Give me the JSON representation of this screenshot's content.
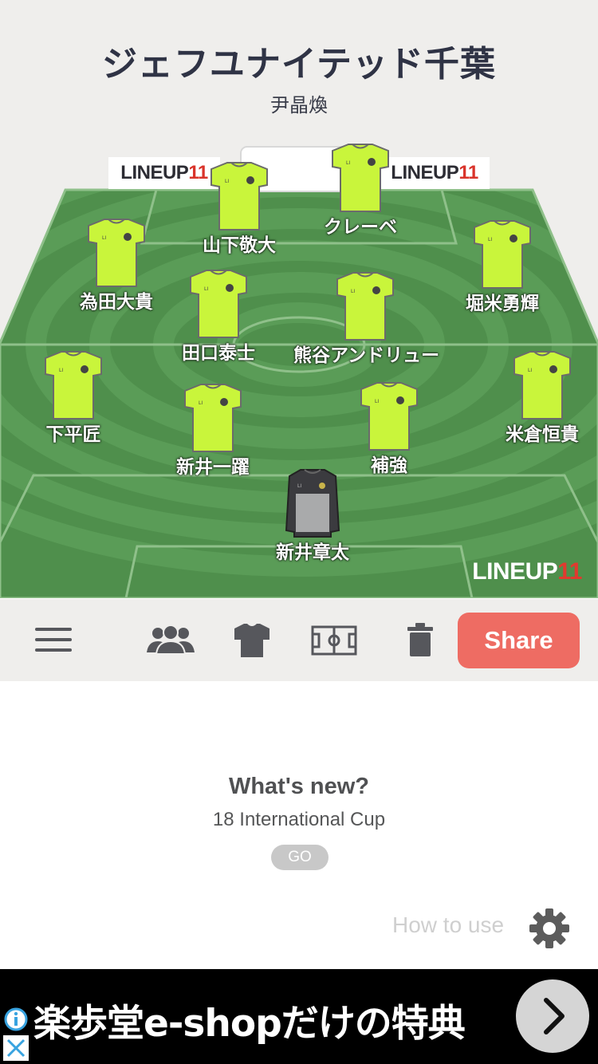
{
  "team": {
    "name": "ジェフユナイテッド千葉",
    "coach": "尹晶煥"
  },
  "brand": {
    "prefix": "LINEUP",
    "number": "11"
  },
  "colors": {
    "kit": "#c9f53b",
    "gk_kit": "#3b3b3f",
    "pitch": "#4f8f4c",
    "share": "#ee6c63",
    "brand_red": "#d9342b"
  },
  "players": [
    {
      "name": "山下敬大",
      "kit": "field"
    },
    {
      "name": "クレーベ",
      "kit": "field"
    },
    {
      "name": "為田大貴",
      "kit": "field"
    },
    {
      "name": "堀米勇輝",
      "kit": "field"
    },
    {
      "name": "田口泰士",
      "kit": "field"
    },
    {
      "name": "熊谷アンドリュー",
      "kit": "field"
    },
    {
      "name": "下平匠",
      "kit": "field"
    },
    {
      "name": "米倉恒貴",
      "kit": "field"
    },
    {
      "name": "新井一躍",
      "kit": "field"
    },
    {
      "name": "補強",
      "kit": "field"
    },
    {
      "name": "新井章太",
      "kit": "goalkeeper"
    }
  ],
  "toolbar": {
    "icons": [
      "menu-icon",
      "players-icon",
      "shirt-icon",
      "pitch-icon",
      "trash-icon"
    ],
    "share_label": "Share"
  },
  "news": {
    "title": "What's new?",
    "subtitle": "18 International Cup",
    "go_label": "GO"
  },
  "howto": {
    "label": "How to use"
  },
  "ad": {
    "text": "楽歩堂e-shopだけの特典"
  }
}
